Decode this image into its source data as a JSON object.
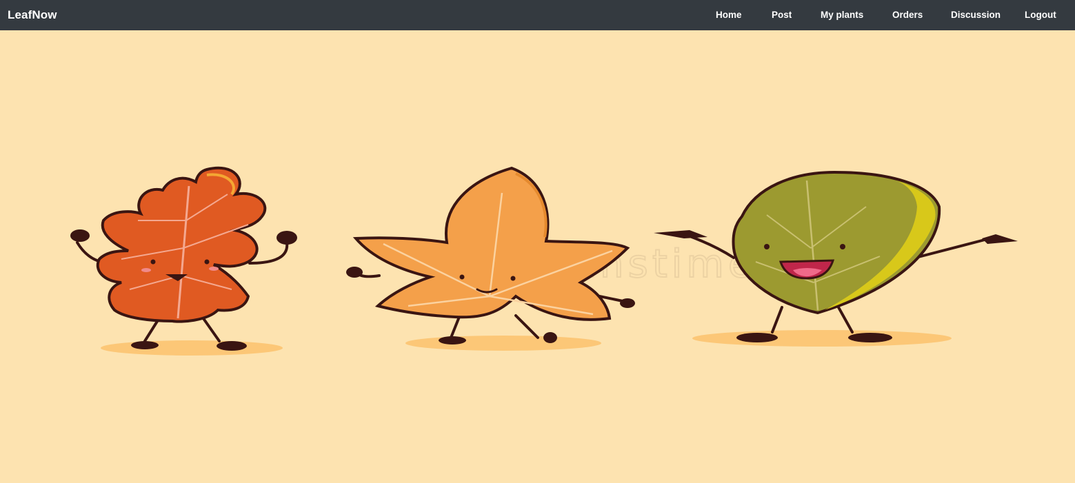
{
  "navbar": {
    "brand": "LeafNow",
    "links": [
      {
        "label": "Home"
      },
      {
        "label": "Post"
      },
      {
        "label": "My plants"
      },
      {
        "label": "Orders"
      },
      {
        "label": "Discussion"
      },
      {
        "label": "Logout"
      }
    ],
    "background": "#343a40",
    "text_color": "#ffffff"
  },
  "hero": {
    "background": "#fde3b0",
    "watermark": "dreamstime",
    "characters": [
      {
        "name": "oak-leaf-character",
        "color": "#e05a22"
      },
      {
        "name": "maple-leaf-character",
        "color": "#f4a04a"
      },
      {
        "name": "round-leaf-character",
        "color": "#9c9a30"
      }
    ]
  }
}
